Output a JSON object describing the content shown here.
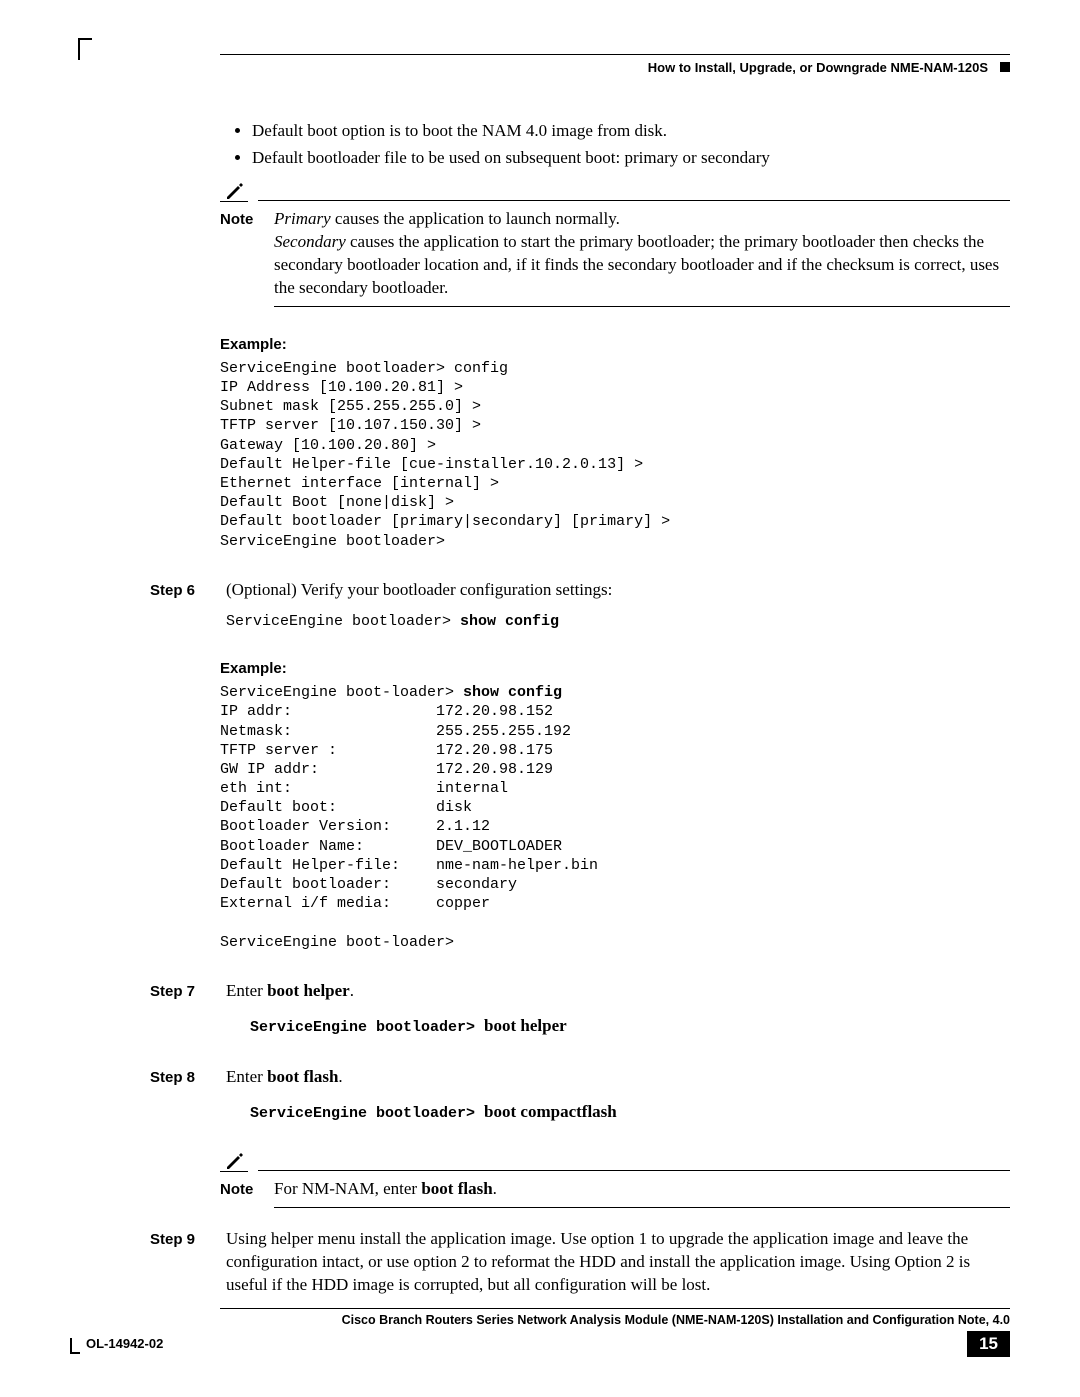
{
  "header": {
    "title": "How to Install, Upgrade, or Downgrade NME-NAM-120S"
  },
  "bullets": [
    "Default boot option is to boot the NAM 4.0 image from disk.",
    "Default bootloader file to be used on subsequent boot: primary or secondary"
  ],
  "note1": {
    "label": "Note",
    "primary_word": "Primary",
    "primary_rest": " causes the application to launch normally.",
    "secondary_word": "Secondary",
    "secondary_rest": " causes the application to start the primary bootloader; the primary bootloader then checks the secondary bootloader location and, if it finds the secondary bootloader and if the checksum is correct, uses the secondary bootloader."
  },
  "example1": {
    "label": "Example:",
    "code": "ServiceEngine bootloader> config\nIP Address [10.100.20.81] >\nSubnet mask [255.255.255.0] >\nTFTP server [10.107.150.30] >\nGateway [10.100.20.80] >\nDefault Helper-file [cue-installer.10.2.0.13] >\nEthernet interface [internal] >\nDefault Boot [none|disk] >\nDefault bootloader [primary|secondary] [primary] >\nServiceEngine bootloader>"
  },
  "step6": {
    "label": "Step 6",
    "text": "(Optional) Verify your bootloader configuration settings:",
    "code_prefix": "ServiceEngine bootloader> ",
    "code_cmd": "show config"
  },
  "example2": {
    "label": "Example:",
    "line1_prefix": "ServiceEngine boot-loader> ",
    "line1_cmd": "show config",
    "body": "IP addr:                172.20.98.152\nNetmask:                255.255.255.192\nTFTP server :           172.20.98.175\nGW IP addr:             172.20.98.129\neth int:                internal\nDefault boot:           disk\nBootloader Version:     2.1.12\nBootloader Name:        DEV_BOOTLOADER\nDefault Helper-file:    nme-nam-helper.bin\nDefault bootloader:     secondary\nExternal i/f media:     copper\n\nServiceEngine boot-loader>"
  },
  "step7": {
    "label": "Step 7",
    "text_pre": "Enter ",
    "text_bold": "boot helper",
    "text_post": ".",
    "code_prefix": "ServiceEngine bootloader> ",
    "code_suffix": "boot helper"
  },
  "step8": {
    "label": "Step 8",
    "text_pre": "Enter ",
    "text_bold": "boot flash",
    "text_post": ".",
    "code_prefix": "ServiceEngine bootloader> ",
    "code_suffix": "boot compactflash"
  },
  "note2": {
    "label": "Note",
    "pre": "For NM-NAM, enter ",
    "bold": "boot flash",
    "post": "."
  },
  "step9": {
    "label": "Step 9",
    "text": "Using helper menu install the application image. Use option 1 to upgrade the application image and leave the configuration intact, or use option 2 to reformat the HDD and install the application image. Using Option 2 is useful if the HDD image is corrupted, but all configuration will be lost."
  },
  "footer": {
    "title": "Cisco Branch Routers Series Network Analysis Module (NME-NAM-120S) Installation and Configuration Note, 4.0",
    "doc": "OL-14942-02",
    "page": "15"
  }
}
